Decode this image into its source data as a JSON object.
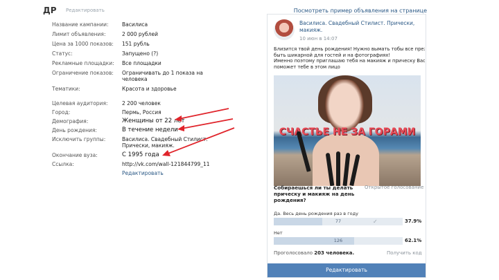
{
  "header": {
    "title": "ДР",
    "edit_label": "Редактировать",
    "preview_link": "Посмотреть пример объявления на странице"
  },
  "params": {
    "campaign": {
      "label": "Название кампании:",
      "value": "Василиса"
    },
    "limit": {
      "label": "Лимит объявления:",
      "value": "2 000 рублей"
    },
    "cpm": {
      "label": "Цена за 1000 показов:",
      "value": "151 рубль"
    },
    "status": {
      "label": "Статус:",
      "value": "Запущено (?)"
    },
    "placements": {
      "label": "Рекламные площадки:",
      "value": "Все площадки"
    },
    "impressions": {
      "label": "Ограничение показов:",
      "value": "Ограничивать до 1 показа на человека"
    },
    "topics": {
      "label": "Тематики:",
      "value": "Красота и здоровье"
    },
    "audience": {
      "label": "Целевая аудитория:",
      "value": "2 200 человек"
    },
    "city": {
      "label": "Город:",
      "value": "Пермь, Россия"
    },
    "demography": {
      "label": "Демография:",
      "value": "Женщины от 22 лет"
    },
    "birthday": {
      "label": "День рождения:",
      "value": "В течение недели"
    },
    "exclude": {
      "label": "Исключить группы:",
      "value": "Василиса. Свадебный Стилист. Прически, макияж."
    },
    "graduation": {
      "label": "Окончание вуза:",
      "value": "С 1995 года"
    },
    "link": {
      "label": "Ссылка:",
      "value": "http://vk.com/wall-121844799_11"
    },
    "edit_link": "Редактировать"
  },
  "post": {
    "author": "Василиса. Свадебный Стилист. Прически, макияж.",
    "time": "10 июн в 14:07",
    "text_lines": [
      "Близится твой день рождения! Нужно вымать тобы все прежне,",
      "быть шикарной для гостей и на фотографиях!",
      "Именно поэтому приглашаю тебя на макияж и прическу Василиса Петрова",
      "поможет тебе в этом лицо"
    ],
    "banner_text": "СЧАСТЬЕ НЕ ЗА ГОРАМИ"
  },
  "poll": {
    "question": "Собираешься ли ты делать прическу и макияж на день рождения?",
    "type": "Открытое голосование",
    "options": [
      {
        "label": "Да. Весь день рождения раз в году",
        "count": "77",
        "percent": "37.9%",
        "share": 0.379
      },
      {
        "label": "Нет",
        "count": "126",
        "percent": "62.1%",
        "share": 0.621
      }
    ],
    "voted_prefix": "Проголосовало",
    "voted_count": "203 человека.",
    "get_code": "Получить код"
  },
  "button": {
    "label": "Редактировать"
  },
  "colors": {
    "accent": "#5181b8",
    "link": "#2a5885",
    "arrow": "#e0242b"
  }
}
